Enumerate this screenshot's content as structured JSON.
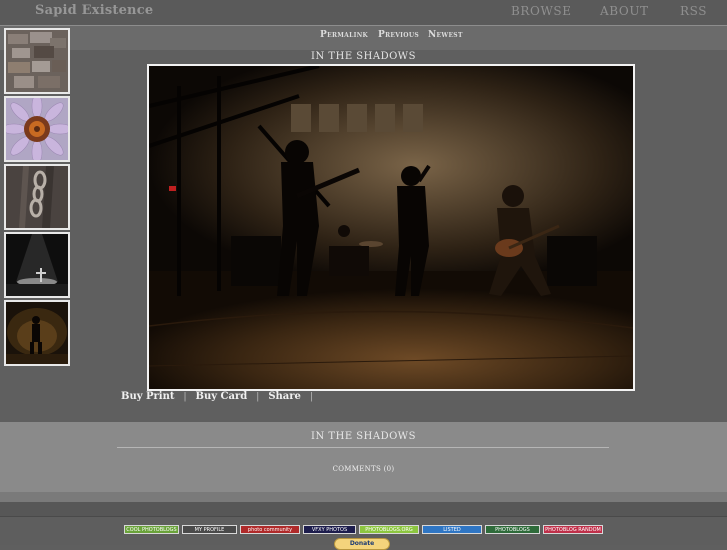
{
  "header": {
    "site_title": "Sapid Existence",
    "nav": {
      "browse": "BROWSE",
      "about": "ABOUT",
      "rss": "RSS"
    }
  },
  "subnav": {
    "permalink": "Permalink",
    "previous": "Previous",
    "newest": "Newest"
  },
  "photo": {
    "title": "IN THE SHADOWS"
  },
  "thumbnails": [
    {
      "subject": "brick-pile"
    },
    {
      "subject": "coneflower"
    },
    {
      "subject": "chain-on-wood"
    },
    {
      "subject": "spotlit-stage"
    },
    {
      "subject": "guitarist-silhouette"
    }
  ],
  "actions": {
    "buy_print": "Buy Print",
    "buy_card": "Buy Card",
    "share": "Share",
    "separator": "|"
  },
  "info": {
    "title": "IN THE SHADOWS",
    "comments": "COMMENTS (0)"
  },
  "footer": {
    "badges": [
      {
        "label": "COOL PHOTOBLOGS",
        "color": "#6aa33a"
      },
      {
        "label": "MY PROFILE",
        "color": "#4a4a4a"
      },
      {
        "label": "photo community",
        "color": "#b02a2a"
      },
      {
        "label": "VFXY PHOTOS",
        "color": "#1d1d4d"
      },
      {
        "label": "PHOTOBLOGS.ORG",
        "color": "#8cc63f"
      },
      {
        "label": "LISTED",
        "color": "#2f76c4"
      },
      {
        "label": "PHOTOBLOGS",
        "color": "#2e6b3a"
      },
      {
        "label": "PHOTOBLOG RANDOM",
        "color": "#c0304a"
      }
    ],
    "donate": "Donate"
  },
  "colors": {
    "background": "#5f5f5f",
    "panel": "#8a8a8a",
    "frame": "#f2f2f2"
  }
}
